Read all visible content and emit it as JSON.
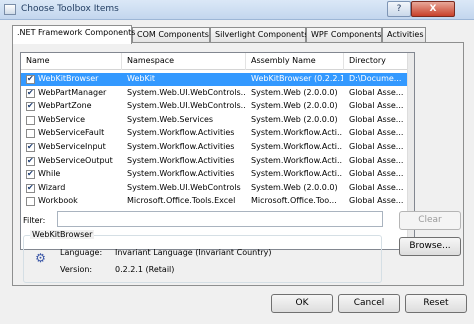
{
  "window": {
    "title": "Choose Toolbox Items",
    "help_label": "?",
    "close_label": "X"
  },
  "tabs": [
    {
      "label": ".NET Framework Components"
    },
    {
      "label": "COM Components"
    },
    {
      "label": "Silverlight Components"
    },
    {
      "label": "WPF Components"
    },
    {
      "label": "Activities"
    }
  ],
  "grid": {
    "columns": [
      "Name",
      "Namespace",
      "Assembly Name",
      "Directory"
    ],
    "rows": [
      {
        "checked": true,
        "name": "WebKitBrowser",
        "namespace": "WebKit",
        "assembly": "WebKitBrowser (0.2.2.1)",
        "directory": "D:\\Docume..."
      },
      {
        "checked": true,
        "name": "WebPartManager",
        "namespace": "System.Web.UI.WebControls...",
        "assembly": "System.Web (2.0.0.0)",
        "directory": "Global Asse..."
      },
      {
        "checked": true,
        "name": "WebPartZone",
        "namespace": "System.Web.UI.WebControls...",
        "assembly": "System.Web (2.0.0.0)",
        "directory": "Global Asse..."
      },
      {
        "checked": false,
        "name": "WebService",
        "namespace": "System.Web.Services",
        "assembly": "System.Web (2.0.0.0)",
        "directory": "Global Asse..."
      },
      {
        "checked": false,
        "name": "WebServiceFault",
        "namespace": "System.Workflow.Activities",
        "assembly": "System.Workflow.Acti...",
        "directory": "Global Asse..."
      },
      {
        "checked": true,
        "name": "WebServiceInput",
        "namespace": "System.Workflow.Activities",
        "assembly": "System.Workflow.Acti...",
        "directory": "Global Asse..."
      },
      {
        "checked": true,
        "name": "WebServiceOutput",
        "namespace": "System.Workflow.Activities",
        "assembly": "System.Workflow.Acti...",
        "directory": "Global Asse..."
      },
      {
        "checked": true,
        "name": "While",
        "namespace": "System.Workflow.Activities",
        "assembly": "System.Workflow.Acti...",
        "directory": "Global Asse..."
      },
      {
        "checked": true,
        "name": "Wizard",
        "namespace": "System.Web.UI.WebControls",
        "assembly": "System.Web (2.0.0.0)",
        "directory": "Global Asse..."
      },
      {
        "checked": false,
        "name": "Workbook",
        "namespace": "Microsoft.Office.Tools.Excel",
        "assembly": "Microsoft.Office.Too...",
        "directory": "Global Asse..."
      }
    ]
  },
  "filter": {
    "label": "Filter:",
    "value": ""
  },
  "buttons": {
    "clear": "Clear",
    "browse": "Browse...",
    "ok": "OK",
    "cancel": "Cancel",
    "reset": "Reset"
  },
  "details": {
    "title": "WebKitBrowser",
    "icon": "gear-icon",
    "language_label": "Language:",
    "language_value": "Invariant Language (Invariant Country)",
    "version_label": "Version:",
    "version_value": "0.2.2.1 (Retail)"
  }
}
